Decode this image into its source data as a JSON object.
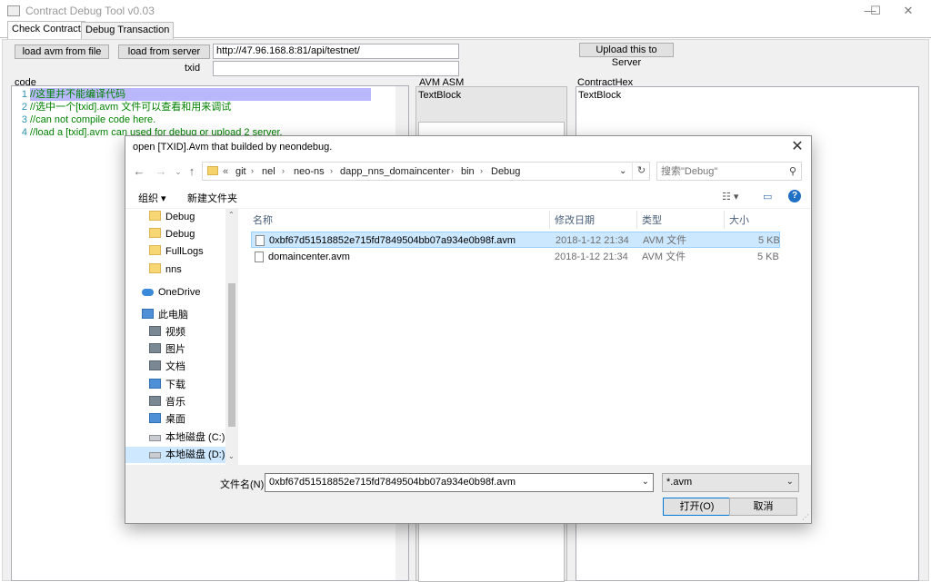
{
  "window": {
    "title": "Contract Debug Tool v0.03",
    "minimize": "—",
    "maximize": "☐",
    "close": "✕"
  },
  "tabs": [
    "Check Contract",
    "Debug Transaction"
  ],
  "toolbar": {
    "load_avm_file": "load avm from file",
    "load_server": "load from server",
    "server_url": "http://47.96.168.8:81/api/testnet/",
    "txid_label": "txid",
    "txid_value": "",
    "upload": "Upload this to Server"
  },
  "code": {
    "label": "code",
    "lines": [
      {
        "num": "1",
        "text": "//这里并不能编译代码"
      },
      {
        "num": "2",
        "text": "//选中一个[txid].avm 文件可以查看和用来调试"
      },
      {
        "num": "3",
        "text": "//can not compile code here."
      },
      {
        "num": "4",
        "text": "//load a [txid].avm can used for debug or upload 2 server."
      }
    ]
  },
  "asm": {
    "label": "AVM ASM",
    "text": "TextBlock"
  },
  "hex": {
    "label": "ContractHex",
    "text": "TextBlock"
  },
  "dialog": {
    "title": "open [TXID].Avm that builded by neondebug.",
    "close": "✕",
    "nav": {
      "back": "←",
      "forward": "→",
      "up": "↑"
    },
    "path_prefix": "«",
    "path": [
      "git",
      "nel",
      "neo-ns",
      "dapp_nns_domaincenter",
      "bin",
      "Debug"
    ],
    "path_dropdown": "⌄",
    "refresh": "↻",
    "search_placeholder": "搜索\"Debug\"",
    "search_icon": "⚲",
    "organize": "组织 ▾",
    "new_folder": "新建文件夹",
    "view_icon": "☷ ▾",
    "pane_icon": "▭",
    "help_icon": "?",
    "nav_items": [
      {
        "icon": "folder",
        "label": "Debug"
      },
      {
        "icon": "folder",
        "label": "Debug"
      },
      {
        "icon": "folder",
        "label": "FullLogs"
      },
      {
        "icon": "folder",
        "label": "nns"
      },
      {
        "icon": "cloud",
        "label": "OneDrive"
      },
      {
        "icon": "pc",
        "label": "此电脑"
      },
      {
        "icon": "gray",
        "label": "视频"
      },
      {
        "icon": "gray",
        "label": "图片"
      },
      {
        "icon": "gray",
        "label": "文档"
      },
      {
        "icon": "pc",
        "label": "下载"
      },
      {
        "icon": "gray",
        "label": "音乐"
      },
      {
        "icon": "pc",
        "label": "桌面"
      },
      {
        "icon": "drive",
        "label": "本地磁盘 (C:)"
      },
      {
        "icon": "drive",
        "label": "本地磁盘 (D:)"
      }
    ],
    "columns": {
      "name": "名称",
      "date": "修改日期",
      "type": "类型",
      "size": "大小"
    },
    "files": [
      {
        "name": "0xbf67d51518852e715fd7849504bb07a934e0b98f.avm",
        "date": "2018-1-12 21:34",
        "type": "AVM 文件",
        "size": "5 KB"
      },
      {
        "name": "domaincenter.avm",
        "date": "2018-1-12 21:34",
        "type": "AVM 文件",
        "size": "5 KB"
      }
    ],
    "filename_label": "文件名(N):",
    "filename_value": "0xbf67d51518852e715fd7849504bb07a934e0b98f.avm",
    "filter": "*.avm",
    "open": "打开(O)",
    "cancel": "取消"
  }
}
